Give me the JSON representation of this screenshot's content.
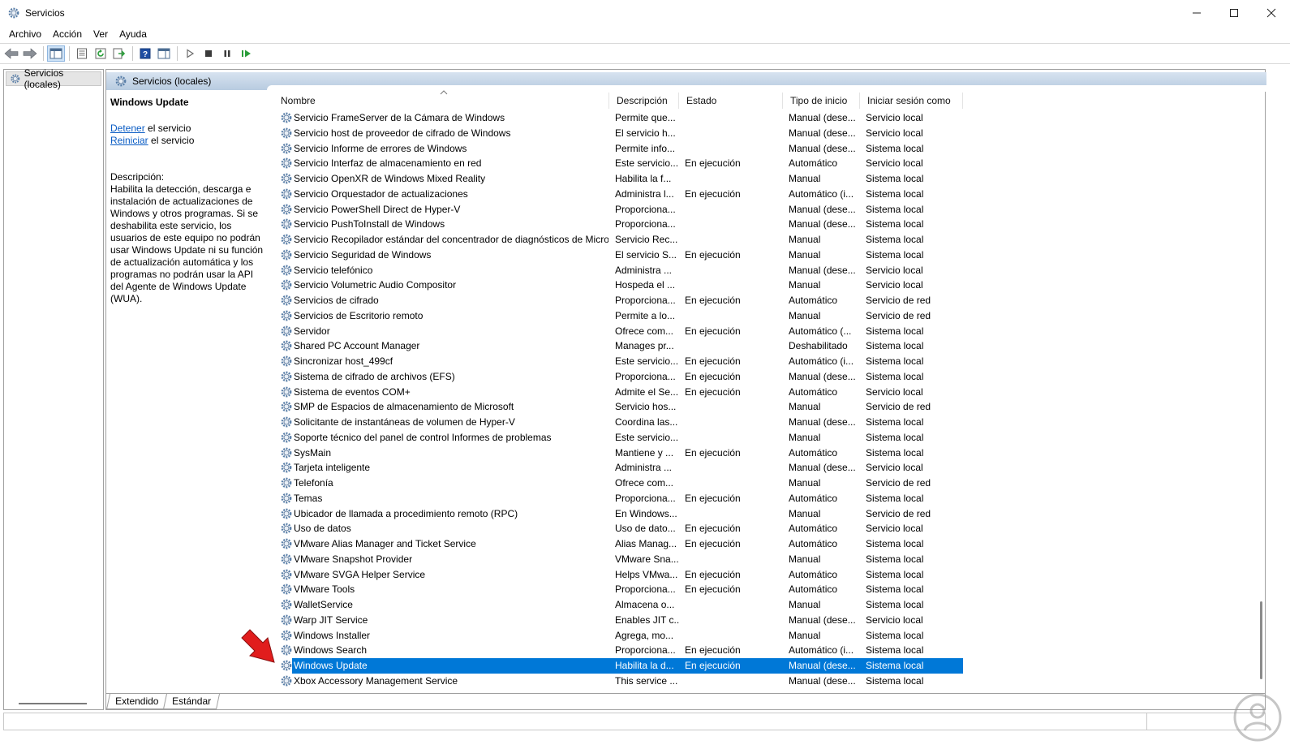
{
  "window": {
    "title": "Servicios"
  },
  "menu": [
    "Archivo",
    "Acción",
    "Ver",
    "Ayuda"
  ],
  "tree": {
    "root_label": "Servicios (locales)"
  },
  "panel": {
    "header_label": "Servicios (locales)"
  },
  "details": {
    "service_name": "Windows Update",
    "stop_link": "Detener",
    "stop_suffix": " el servicio",
    "restart_link": "Reiniciar",
    "restart_suffix": " el servicio",
    "description_label": "Descripción:",
    "description_text": "Habilita la detección, descarga e instalación de actualizaciones de Windows y otros programas. Si se deshabilita este servicio, los usuarios de este equipo no podrán usar Windows Update ni su función de actualización automática y los programas no podrán usar la API del Agente de Windows Update (WUA)."
  },
  "columns": {
    "name": "Nombre",
    "description": "Descripción",
    "state": "Estado",
    "startup": "Tipo de inicio",
    "logon": "Iniciar sesión como"
  },
  "services": [
    {
      "name": "Servicio FrameServer de la Cámara de Windows",
      "desc": "Permite que...",
      "state": "",
      "start": "Manual (dese...",
      "logon": "Servicio local"
    },
    {
      "name": "Servicio host de proveedor de cifrado de Windows",
      "desc": "El servicio h...",
      "state": "",
      "start": "Manual (dese...",
      "logon": "Servicio local"
    },
    {
      "name": "Servicio Informe de errores de Windows",
      "desc": "Permite info...",
      "state": "",
      "start": "Manual (dese...",
      "logon": "Sistema local"
    },
    {
      "name": "Servicio Interfaz de almacenamiento en red",
      "desc": "Este servicio...",
      "state": "En ejecución",
      "start": "Automático",
      "logon": "Servicio local"
    },
    {
      "name": "Servicio OpenXR de Windows Mixed Reality",
      "desc": "Habilita la f...",
      "state": "",
      "start": "Manual",
      "logon": "Sistema local"
    },
    {
      "name": "Servicio Orquestador de actualizaciones",
      "desc": "Administra l...",
      "state": "En ejecución",
      "start": "Automático (i...",
      "logon": "Sistema local"
    },
    {
      "name": "Servicio PowerShell Direct de Hyper-V",
      "desc": "Proporciona...",
      "state": "",
      "start": "Manual (dese...",
      "logon": "Sistema local"
    },
    {
      "name": "Servicio PushToInstall de Windows",
      "desc": "Proporciona...",
      "state": "",
      "start": "Manual (dese...",
      "logon": "Sistema local"
    },
    {
      "name": "Servicio Recopilador estándar del concentrador de diagnósticos de Micro...",
      "desc": "Servicio Rec...",
      "state": "",
      "start": "Manual",
      "logon": "Sistema local"
    },
    {
      "name": "Servicio Seguridad de Windows",
      "desc": "El servicio S...",
      "state": "En ejecución",
      "start": "Manual",
      "logon": "Sistema local"
    },
    {
      "name": "Servicio telefónico",
      "desc": "Administra ...",
      "state": "",
      "start": "Manual (dese...",
      "logon": "Servicio local"
    },
    {
      "name": "Servicio Volumetric Audio Compositor",
      "desc": "Hospeda el ...",
      "state": "",
      "start": "Manual",
      "logon": "Servicio local"
    },
    {
      "name": "Servicios de cifrado",
      "desc": "Proporciona...",
      "state": "En ejecución",
      "start": "Automático",
      "logon": "Servicio de red"
    },
    {
      "name": "Servicios de Escritorio remoto",
      "desc": "Permite a lo...",
      "state": "",
      "start": "Manual",
      "logon": "Servicio de red"
    },
    {
      "name": "Servidor",
      "desc": "Ofrece com...",
      "state": "En ejecución",
      "start": "Automático (...",
      "logon": "Sistema local"
    },
    {
      "name": "Shared PC Account Manager",
      "desc": "Manages pr...",
      "state": "",
      "start": "Deshabilitado",
      "logon": "Sistema local"
    },
    {
      "name": "Sincronizar host_499cf",
      "desc": "Este servicio...",
      "state": "En ejecución",
      "start": "Automático (i...",
      "logon": "Sistema local"
    },
    {
      "name": "Sistema de cifrado de archivos (EFS)",
      "desc": "Proporciona...",
      "state": "En ejecución",
      "start": "Manual (dese...",
      "logon": "Sistema local"
    },
    {
      "name": "Sistema de eventos COM+",
      "desc": "Admite el Se...",
      "state": "En ejecución",
      "start": "Automático",
      "logon": "Servicio local"
    },
    {
      "name": "SMP de Espacios de almacenamiento de Microsoft",
      "desc": "Servicio hos...",
      "state": "",
      "start": "Manual",
      "logon": "Servicio de red"
    },
    {
      "name": "Solicitante de instantáneas de volumen de Hyper-V",
      "desc": "Coordina las...",
      "state": "",
      "start": "Manual (dese...",
      "logon": "Sistema local"
    },
    {
      "name": "Soporte técnico del panel de control Informes de problemas",
      "desc": "Este servicio...",
      "state": "",
      "start": "Manual",
      "logon": "Sistema local"
    },
    {
      "name": "SysMain",
      "desc": "Mantiene y ...",
      "state": "En ejecución",
      "start": "Automático",
      "logon": "Sistema local"
    },
    {
      "name": "Tarjeta inteligente",
      "desc": "Administra ...",
      "state": "",
      "start": "Manual (dese...",
      "logon": "Servicio local"
    },
    {
      "name": "Telefonía",
      "desc": "Ofrece com...",
      "state": "",
      "start": "Manual",
      "logon": "Servicio de red"
    },
    {
      "name": "Temas",
      "desc": "Proporciona...",
      "state": "En ejecución",
      "start": "Automático",
      "logon": "Sistema local"
    },
    {
      "name": "Ubicador de llamada a procedimiento remoto (RPC)",
      "desc": "En Windows...",
      "state": "",
      "start": "Manual",
      "logon": "Servicio de red"
    },
    {
      "name": "Uso de datos",
      "desc": "Uso de dato...",
      "state": "En ejecución",
      "start": "Automático",
      "logon": "Servicio local"
    },
    {
      "name": "VMware Alias Manager and Ticket Service",
      "desc": "Alias Manag...",
      "state": "En ejecución",
      "start": "Automático",
      "logon": "Sistema local"
    },
    {
      "name": "VMware Snapshot Provider",
      "desc": "VMware Sna...",
      "state": "",
      "start": "Manual",
      "logon": "Sistema local"
    },
    {
      "name": "VMware SVGA Helper Service",
      "desc": "Helps VMwa...",
      "state": "En ejecución",
      "start": "Automático",
      "logon": "Sistema local"
    },
    {
      "name": "VMware Tools",
      "desc": "Proporciona...",
      "state": "En ejecución",
      "start": "Automático",
      "logon": "Sistema local"
    },
    {
      "name": "WalletService",
      "desc": "Almacena o...",
      "state": "",
      "start": "Manual",
      "logon": "Sistema local"
    },
    {
      "name": "Warp JIT Service",
      "desc": "Enables JIT c...",
      "state": "",
      "start": "Manual (dese...",
      "logon": "Servicio local"
    },
    {
      "name": "Windows Installer",
      "desc": "Agrega, mo...",
      "state": "",
      "start": "Manual",
      "logon": "Sistema local"
    },
    {
      "name": "Windows Search",
      "desc": "Proporciona...",
      "state": "En ejecución",
      "start": "Automático (i...",
      "logon": "Sistema local"
    },
    {
      "name": "Windows Update",
      "desc": "Habilita la d...",
      "state": "En ejecución",
      "start": "Manual (dese...",
      "logon": "Sistema local",
      "selected": true
    },
    {
      "name": "Xbox Accessory Management Service",
      "desc": "This service ...",
      "state": "",
      "start": "Manual (dese...",
      "logon": "Sistema local"
    }
  ],
  "tabs": [
    "Extendido",
    "Estándar"
  ],
  "colors": {
    "selection": "#0078d7",
    "link": "#0a5cc4",
    "header_gradient_top": "#d7e3f0",
    "header_gradient_bottom": "#b8cbe0",
    "arrow": "#e11d1d"
  }
}
